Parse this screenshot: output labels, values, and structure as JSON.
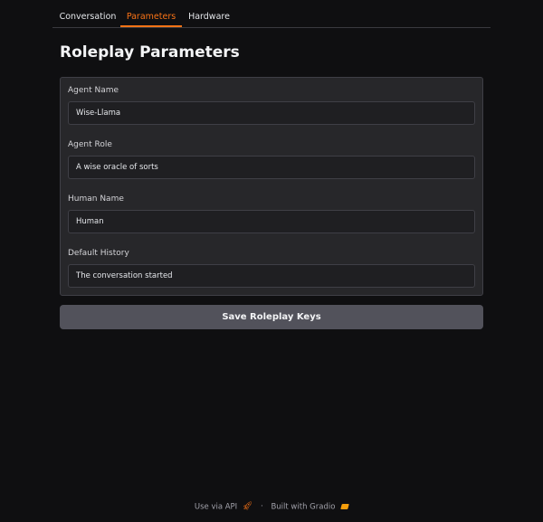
{
  "tabs": [
    {
      "label": "Conversation",
      "active": false
    },
    {
      "label": "Parameters",
      "active": true
    },
    {
      "label": "Hardware",
      "active": false
    }
  ],
  "page_title": "Roleplay Parameters",
  "fields": [
    {
      "label": "Agent Name",
      "value": "Wise-Llama"
    },
    {
      "label": "Agent Role",
      "value": "A wise oracle of sorts"
    },
    {
      "label": "Human Name",
      "value": "Human"
    },
    {
      "label": "Default History",
      "value": "The conversation started"
    }
  ],
  "save_button_label": "Save Roleplay Keys",
  "footer": {
    "api_link": "Use via API",
    "separator": "·",
    "built_with": "Built with Gradio"
  },
  "colors": {
    "accent": "#f97316",
    "background": "#0f0f11",
    "panel": "#27272a",
    "button": "#52525b"
  },
  "icons": {
    "api": "rocket-icon",
    "gradio": "gradio-logo-icon"
  }
}
